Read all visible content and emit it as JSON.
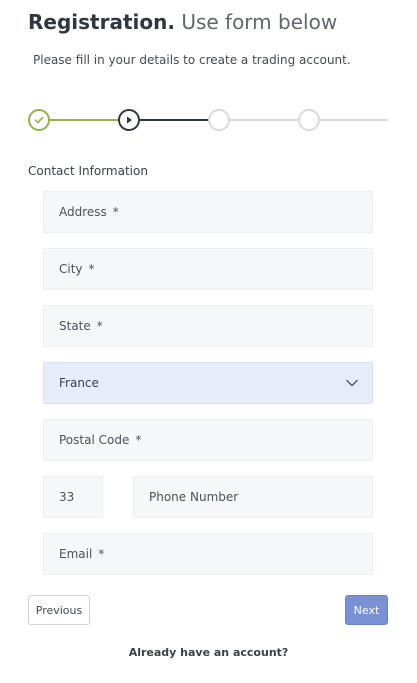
{
  "header": {
    "title_bold": "Registration.",
    "title_light": "Use form below",
    "subtitle": "Please fill in your details to create a trading account."
  },
  "stepper": {
    "total_steps": 4,
    "current_step": 2,
    "colors": {
      "done": "#8fb44a",
      "active": "#2f3742",
      "todo": "#d9d9d9"
    }
  },
  "section": {
    "label": "Contact Information"
  },
  "form": {
    "address": {
      "placeholder": "Address",
      "required_mark": "*"
    },
    "city": {
      "placeholder": "City",
      "required_mark": "*"
    },
    "state": {
      "placeholder": "State",
      "required_mark": "*"
    },
    "country": {
      "selected": "France",
      "icon": "chevron-down-icon"
    },
    "postal_code": {
      "placeholder": "Postal Code",
      "required_mark": "*"
    },
    "phone_code": {
      "value": "33"
    },
    "phone_number": {
      "placeholder": "Phone Number"
    },
    "email": {
      "placeholder": "Email",
      "required_mark": "*"
    }
  },
  "buttons": {
    "previous": "Previous",
    "next": "Next",
    "next_color": "#7a90d4"
  },
  "footer": {
    "login_text": "Already have an account?"
  }
}
